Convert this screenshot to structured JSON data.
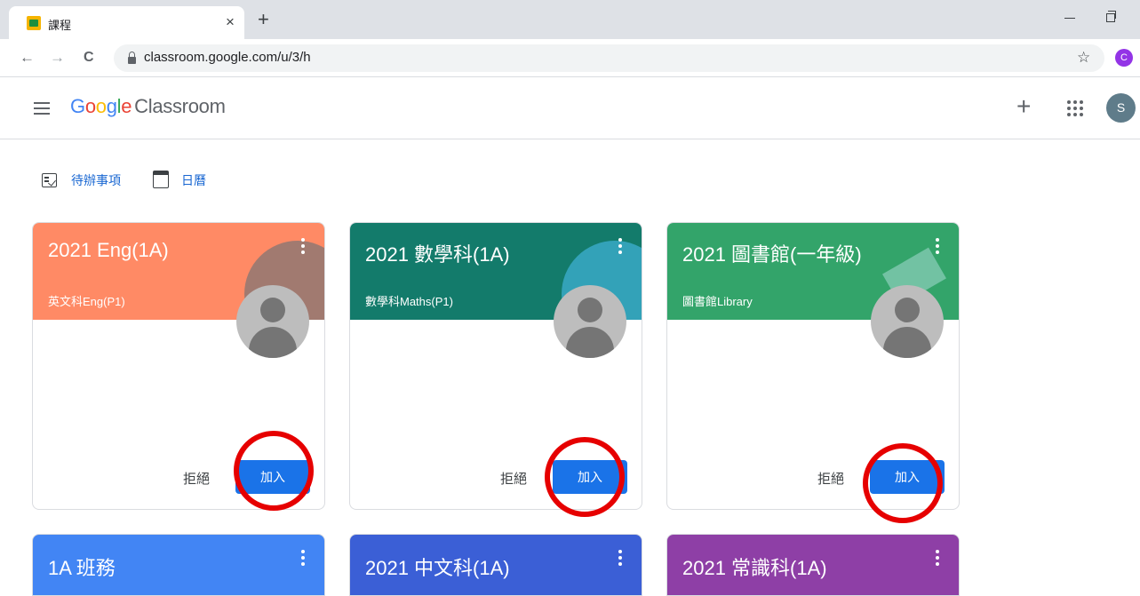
{
  "browser": {
    "tab_title": "課程",
    "tab_close": "×",
    "new_tab": "+",
    "back": "←",
    "forward": "→",
    "reload": "C",
    "url": "classroom.google.com/u/3/h",
    "star": "☆",
    "profile_initial": "C"
  },
  "header": {
    "logo": {
      "g": "G",
      "o1": "o",
      "o2": "o",
      "g2": "g",
      "l": "l",
      "e": "e",
      "product": "Classroom"
    },
    "add": "+",
    "account_initial": "S"
  },
  "quick_links": {
    "todo": "待辦事項",
    "calendar": "日曆"
  },
  "colors": {
    "accent": "#1a73e8",
    "highlight_ring": "#e60000"
  },
  "invited_classes": [
    {
      "title": "2021 Eng(1A)",
      "section": "英文科Eng(P1)",
      "color": "#ff8a65",
      "decline": "拒絕",
      "join": "加入"
    },
    {
      "title": "2021 數學科(1A)",
      "section": "數學科Maths(P1)",
      "color": "#137b6b",
      "decline": "拒絕",
      "join": "加入"
    },
    {
      "title": "2021 圖書館(一年級)",
      "section": "圖書館Library",
      "color": "#33a46a",
      "decline": "拒絕",
      "join": "加入"
    }
  ],
  "more_classes": [
    {
      "title": "1A 班務",
      "color": "#4285f4"
    },
    {
      "title": "2021 中文科(1A)",
      "color": "#3b5fd6"
    },
    {
      "title": "2021 常識科(1A)",
      "color": "#8e3fa6"
    }
  ]
}
